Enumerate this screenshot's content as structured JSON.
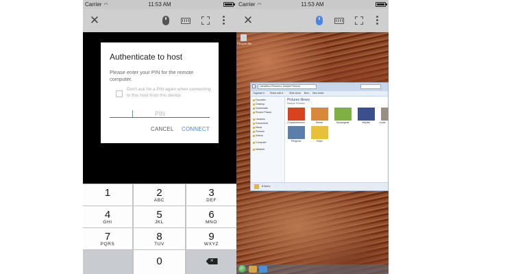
{
  "status_bar": {
    "carrier": "Carrier",
    "time": "11:53 AM"
  },
  "toolbar": {
    "icons": [
      "close-icon",
      "mouse-icon",
      "keyboard-icon",
      "fullscreen-icon",
      "more-vert-icon"
    ],
    "active_mouse_color": "#4a86e8"
  },
  "dialog": {
    "title": "Authenticate to host",
    "message": "Please enter your PIN for the remote computer.",
    "checkbox_label": "Don't ask for a PIN again when connecting to this host from this device.",
    "checkbox_checked": false,
    "pin_placeholder": "PIN",
    "pin_value": "",
    "cancel_label": "CANCEL",
    "connect_label": "CONNECT",
    "accent_color": "#4a86e8"
  },
  "keypad": {
    "keys": [
      {
        "num": "1",
        "letters": ""
      },
      {
        "num": "2",
        "letters": "ABC"
      },
      {
        "num": "3",
        "letters": "DEF"
      },
      {
        "num": "4",
        "letters": "GHI"
      },
      {
        "num": "5",
        "letters": "JKL"
      },
      {
        "num": "6",
        "letters": "MNO"
      },
      {
        "num": "7",
        "letters": "PQRS"
      },
      {
        "num": "8",
        "letters": "TUV"
      },
      {
        "num": "9",
        "letters": "WXYZ"
      },
      {
        "num": "0",
        "letters": ""
      }
    ],
    "delete_icon": "backspace-icon"
  },
  "remote_desktop": {
    "recycle_bin_label": "Recycle Bin",
    "explorer": {
      "address": "Libraries ▸ Pictures ▸ Sample Pictures",
      "commands": [
        "Organize ▾",
        "Share with ▾",
        "Slide show",
        "Burn",
        "New folder"
      ],
      "nav_items": [
        "Favorites",
        "Desktop",
        "Downloads",
        "Recent Places",
        "Libraries",
        "Documents",
        "Music",
        "Pictures",
        "Videos",
        "Computer",
        "Network"
      ],
      "heading": "Pictures library",
      "subheading": "Sample Pictures",
      "thumbnails": [
        {
          "label": "Chrysanthemum",
          "color": "#d8421e"
        },
        {
          "label": "Desert",
          "color": "#d9883b"
        },
        {
          "label": "Hydrangeas",
          "color": "#7fb043"
        },
        {
          "label": "Jellyfish",
          "color": "#3b4f8c"
        },
        {
          "label": "Koala",
          "color": "#9a8f84"
        },
        {
          "label": "Penguins",
          "color": "#5b7fa8"
        },
        {
          "label": "Tulips",
          "color": "#e8c03a"
        }
      ],
      "status": "8 items"
    }
  }
}
